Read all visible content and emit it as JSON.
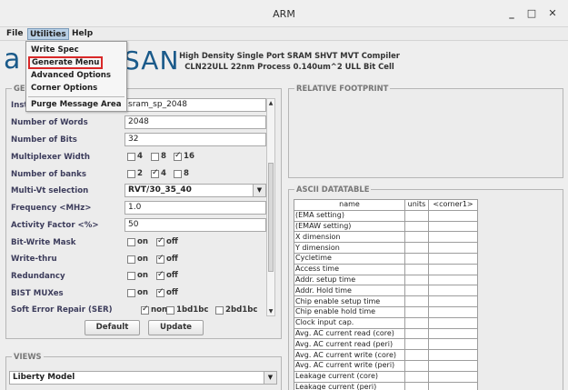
{
  "window": {
    "title": "ARM",
    "minimize_glyph": "_",
    "maximize_glyph": "□",
    "close_glyph": "✕"
  },
  "menubar": {
    "file": "File",
    "utilities": "Utilities",
    "help": "Help"
  },
  "utilities_menu": {
    "items": [
      "Write Spec",
      "Generate Menu",
      "Advanced Options",
      "Corner Options",
      "Purge Message Area"
    ],
    "highlighted": "Generate Menu"
  },
  "banner": {
    "logo_left": "a",
    "logo_right": "SAN",
    "line1": "High Density Single Port SRAM SHVT MVT Compiler",
    "line2": "CLN22ULL 22nm Process 0.140um^2 ULL Bit Cell"
  },
  "general": {
    "legend": "GEN",
    "instance_label": "Inst",
    "instance_value": "sram_sp_2048",
    "number_of_words_label": "Number of Words",
    "number_of_words": "2048",
    "number_of_bits_label": "Number of Bits",
    "number_of_bits": "32",
    "mux_width_label": "Multiplexer Width",
    "mux_options": [
      {
        "label": "4",
        "checked": false
      },
      {
        "label": "8",
        "checked": false
      },
      {
        "label": "16",
        "checked": true
      }
    ],
    "number_of_banks_label": "Number of banks",
    "bank_options": [
      {
        "label": "2",
        "checked": false
      },
      {
        "label": "4",
        "checked": true
      },
      {
        "label": "8",
        "checked": false
      }
    ],
    "multi_vt_label": "Multi-Vt selection",
    "multi_vt_value": "RVT/30_35_40",
    "frequency_label": "Frequency <MHz>",
    "frequency_value": "1.0",
    "activity_label": "Activity Factor <%>",
    "activity_value": "50",
    "bit_write_mask_label": "Bit-Write Mask",
    "write_thru_label": "Write-thru",
    "redundancy_label": "Redundancy",
    "bist_mux_label": "BIST MUXes",
    "on_label": "on",
    "off_label": "off",
    "bit_write_mask": {
      "on": false,
      "off": true
    },
    "write_thru": {
      "on": false,
      "off": true
    },
    "redundancy": {
      "on": false,
      "off": true
    },
    "bist_mux": {
      "on": false,
      "off": true
    },
    "ser_label": "Soft Error Repair (SER)",
    "ser_options": [
      {
        "label": "none",
        "checked": true
      },
      {
        "label": "1bd1bc",
        "checked": false
      },
      {
        "label": "2bd1bc",
        "checked": false
      }
    ],
    "default_button": "Default",
    "update_button": "Update"
  },
  "views": {
    "legend": "VIEWS",
    "selected": "Liberty Model"
  },
  "footprint": {
    "legend": "RELATIVE FOOTPRINT"
  },
  "datatable": {
    "legend": "ASCII DATATABLE",
    "headers": [
      "name",
      "units",
      "<corner1>"
    ],
    "rows": [
      "(EMA setting)",
      "(EMAW setting)",
      "X dimension",
      "Y dimension",
      "Cycletime",
      "Access time",
      "Addr. setup time",
      "Addr. Hold time",
      "Chip enable setup time",
      "Chip enable hold time",
      "Clock input cap.",
      "Avg. AC current read (core)",
      "Avg. AC current read (peri)",
      "Avg. AC current write (core)",
      "Avg. AC current write (peri)",
      "Leakage current (core)",
      "Leakage current (peri)"
    ]
  },
  "colors": {
    "accent": "#1a5a8a",
    "highlight_border": "#d92828",
    "menu_open": "#b8cfe5"
  }
}
